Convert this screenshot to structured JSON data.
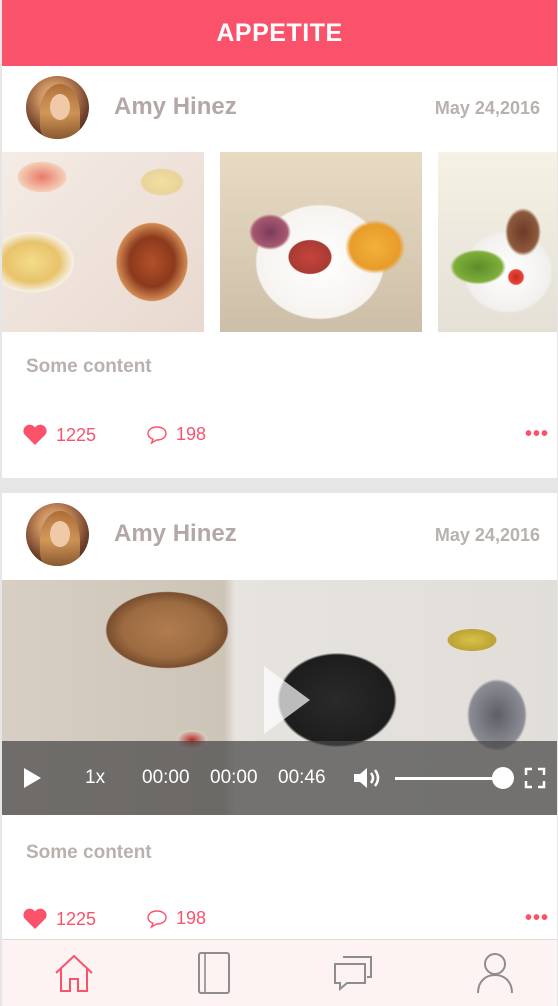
{
  "app": {
    "title": "APPETITE"
  },
  "colors": {
    "accent": "#fb526c",
    "muted_text": "#b3a8a6",
    "tabbar_bg": "#fdf3f3"
  },
  "posts": [
    {
      "author": "Amy Hinez",
      "date": "May 24,2016",
      "media_type": "gallery",
      "gallery_count": 3,
      "content": "Some content",
      "likes": "1225",
      "comments": "198",
      "icons": {
        "like": "heart-icon",
        "comment": "comment-bubble-icon",
        "more": "more-dots-icon"
      }
    },
    {
      "author": "Amy Hinez",
      "date": "May 24,2016",
      "media_type": "video",
      "video": {
        "speed": "1x",
        "current_time": "00:00",
        "middle_time": "00:00",
        "duration": "00:46",
        "volume": 0.9,
        "icons": {
          "play": "play-icon",
          "volume": "volume-icon",
          "fullscreen": "fullscreen-icon",
          "big_play": "big-play-icon"
        }
      },
      "content": "Some content",
      "likes": "1225",
      "comments": "198",
      "icons": {
        "like": "heart-icon",
        "comment": "comment-bubble-icon",
        "more": "more-dots-icon"
      }
    }
  ],
  "tabbar": {
    "items": [
      {
        "name": "home",
        "icon": "home-icon",
        "active": true
      },
      {
        "name": "book",
        "icon": "book-icon",
        "active": false
      },
      {
        "name": "messages",
        "icon": "chat-icon",
        "active": false
      },
      {
        "name": "profile",
        "icon": "user-icon",
        "active": false
      }
    ]
  }
}
